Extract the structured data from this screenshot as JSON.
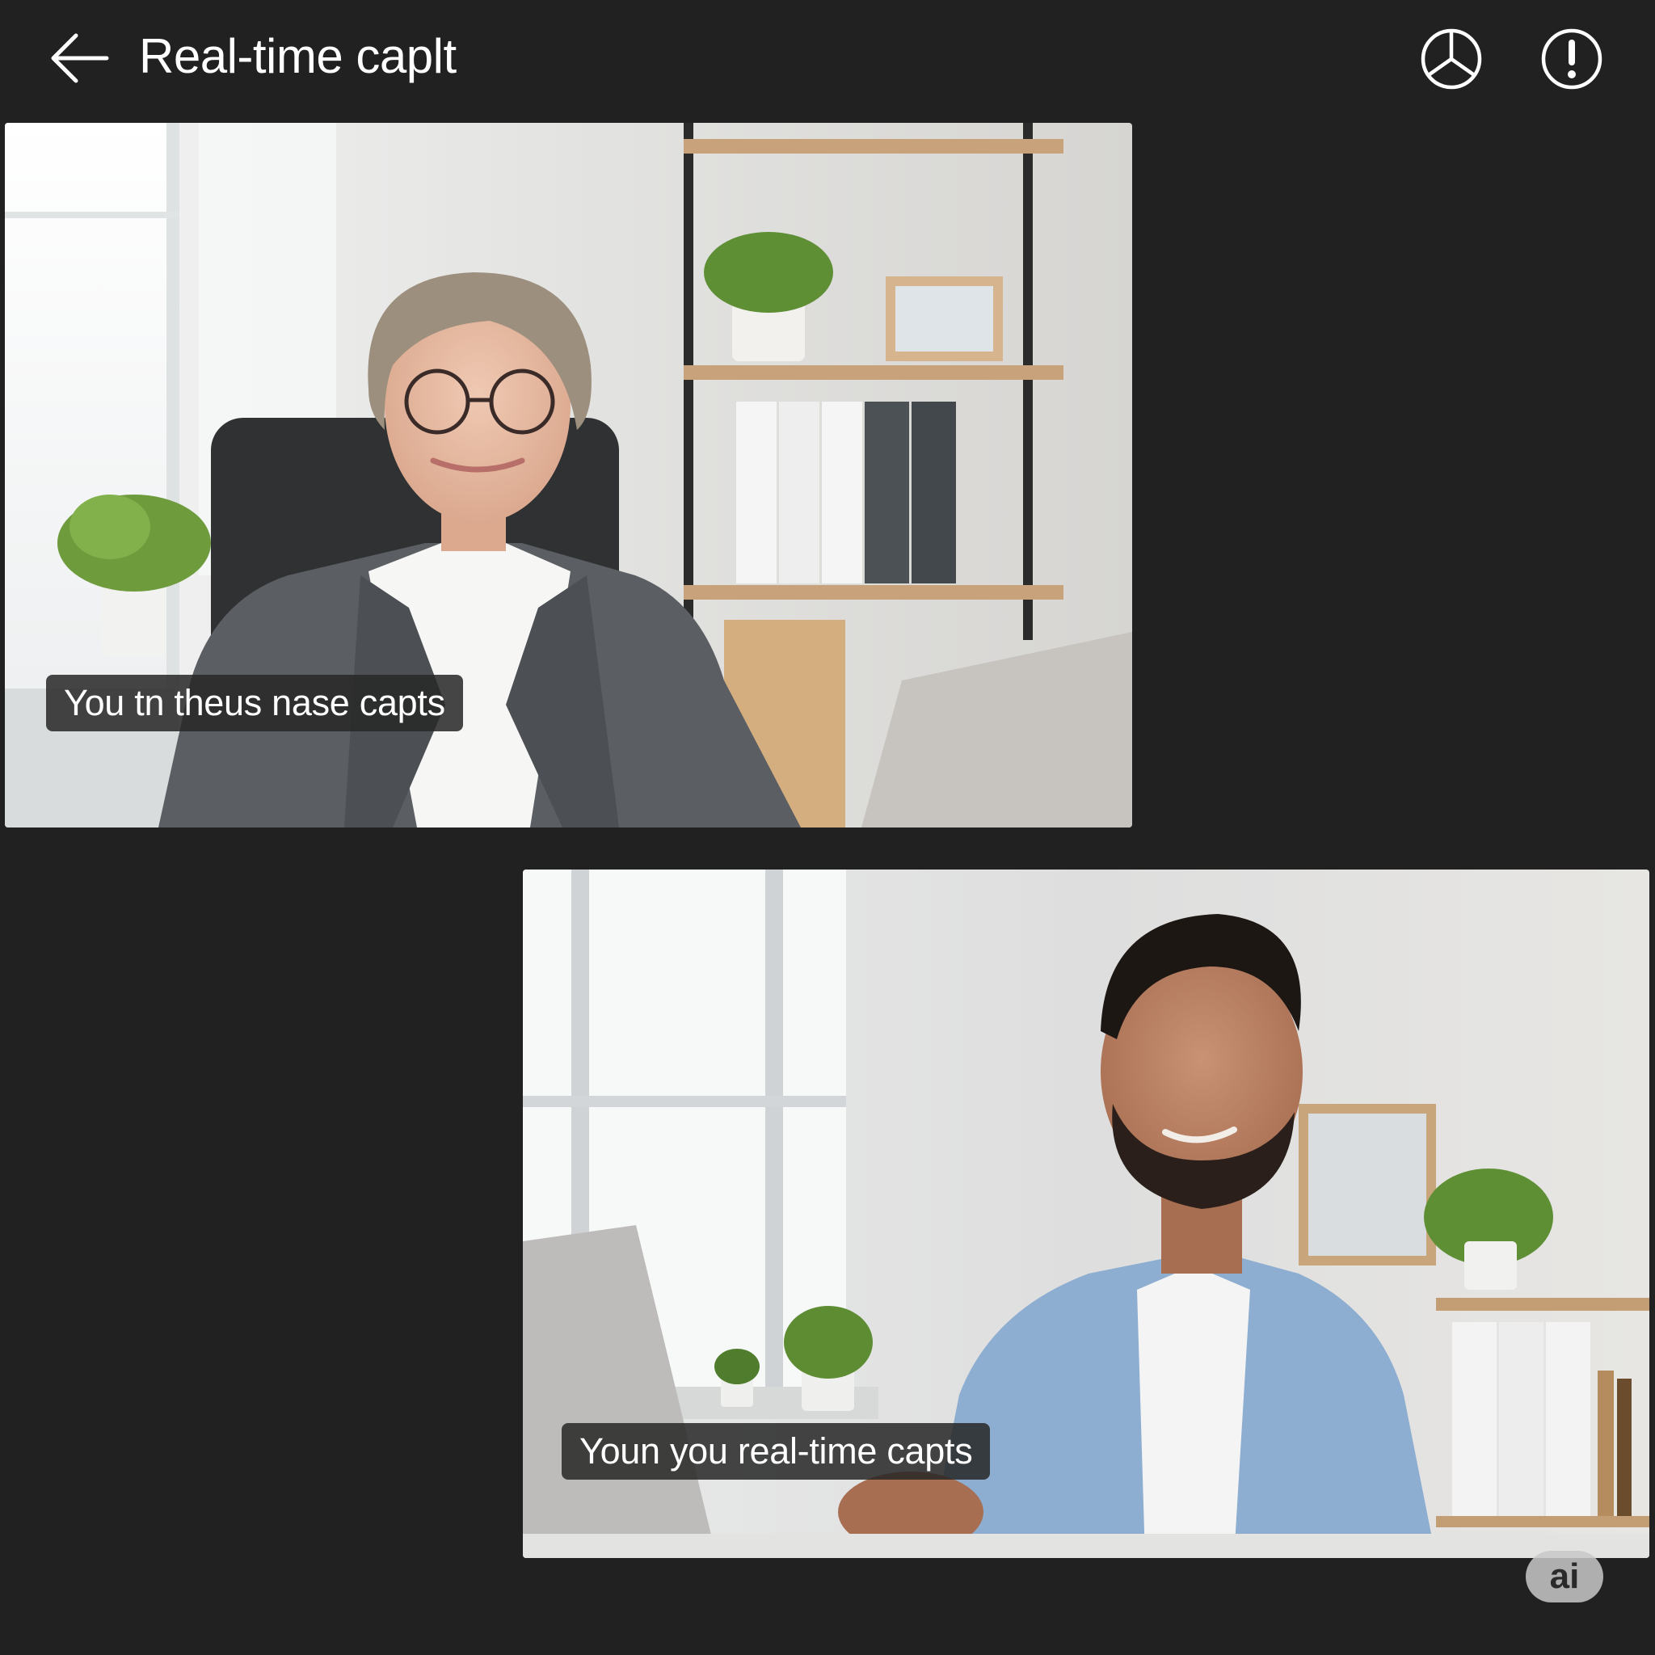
{
  "header": {
    "title": "Real-time caplt",
    "back_icon": "arrow-left-icon",
    "actions": [
      {
        "icon": "participants-icon"
      },
      {
        "icon": "alert-icon"
      }
    ]
  },
  "tiles": [
    {
      "caption": "You tn theus nase capts"
    },
    {
      "caption": "Youn you real-time capts"
    }
  ],
  "badge": {
    "label": "ai"
  },
  "colors": {
    "background": "#212121",
    "caption_bg": "#282828",
    "text": "#ffffff",
    "badge_bg": "#c8c8c8"
  }
}
